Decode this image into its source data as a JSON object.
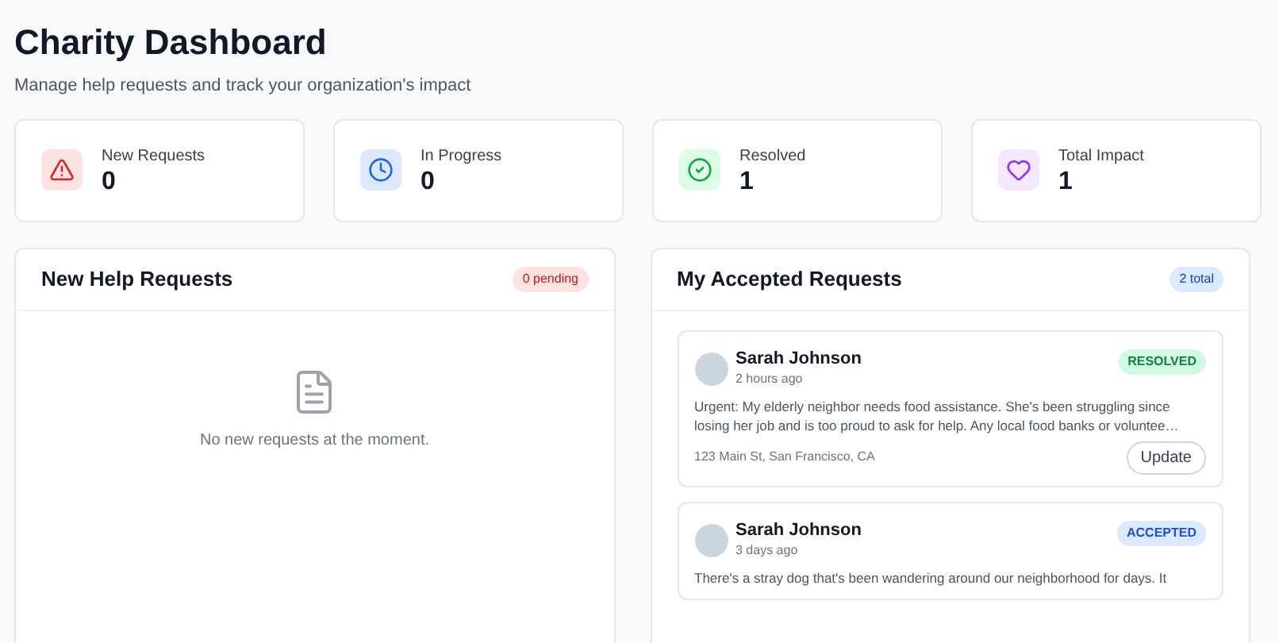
{
  "header": {
    "title": "Charity Dashboard",
    "subtitle": "Manage help requests and track your organization's impact"
  },
  "stats": [
    {
      "kind": "alert",
      "label": "New Requests",
      "value": "0"
    },
    {
      "kind": "clock",
      "label": "In Progress",
      "value": "0"
    },
    {
      "kind": "check",
      "label": "Resolved",
      "value": "1"
    },
    {
      "kind": "heart",
      "label": "Total Impact",
      "value": "1"
    }
  ],
  "new_requests": {
    "title": "New Help Requests",
    "badge": "0 pending",
    "empty_message": "No new requests at the moment."
  },
  "accepted": {
    "title": "My Accepted Requests",
    "badge": "2 total",
    "requests": [
      {
        "name": "Sarah Johnson",
        "time": "2 hours ago",
        "status": "RESOLVED",
        "kind": "resolved",
        "text": "Urgent: My elderly neighbor needs food assistance. She's been struggling since losing her job and is too proud to ask for help. Any local food banks or voluntee…",
        "location": "123 Main St, San Francisco, CA",
        "button": "Update"
      },
      {
        "name": "Sarah Johnson",
        "time": "3 days ago",
        "status": "ACCEPTED",
        "kind": "accepted",
        "text": "There's a stray dog that's been wandering around our neighborhood for days. It"
      }
    ]
  }
}
